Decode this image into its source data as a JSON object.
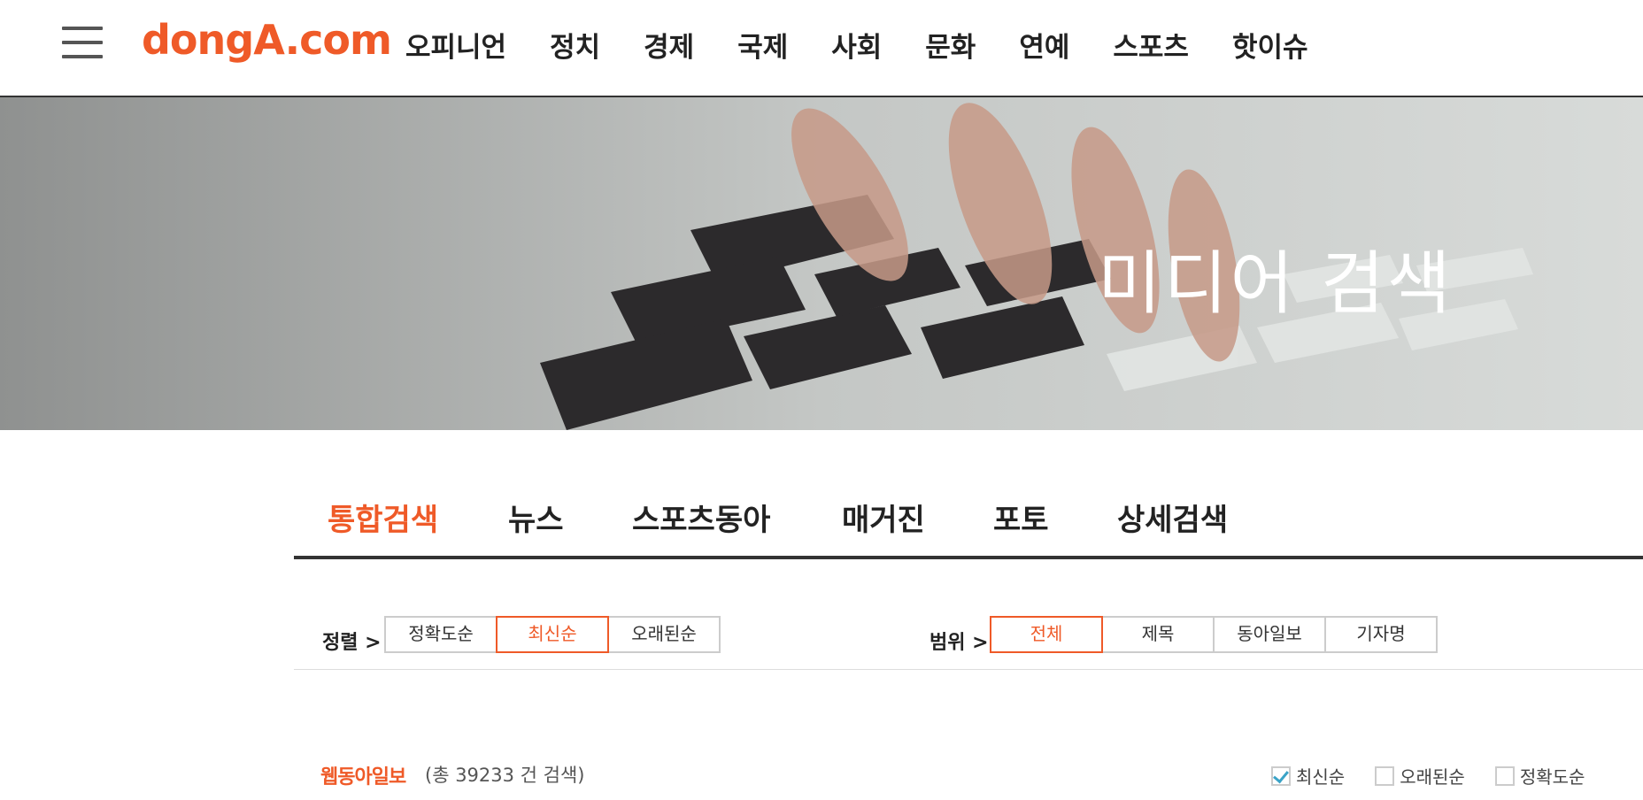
{
  "header": {
    "logo": "dongA.com",
    "menu_icon": "hamburger-menu-icon",
    "nav": [
      "오피니언",
      "정치",
      "경제",
      "국제",
      "사회",
      "문화",
      "연예",
      "스포츠",
      "핫이슈"
    ]
  },
  "hero": {
    "title": "미디어 검색"
  },
  "tabs": [
    "통합검색",
    "뉴스",
    "스포츠동아",
    "매거진",
    "포토",
    "상세검색"
  ],
  "active_tab": "통합검색",
  "sort": {
    "label": "정렬 >",
    "options": [
      "정확도순",
      "최신순",
      "오래된순"
    ],
    "active": "최신순"
  },
  "scope": {
    "label": "범위 >",
    "options": [
      "전체",
      "제목",
      "동아일보",
      "기자명"
    ],
    "active": "전체"
  },
  "result": {
    "section_title": "웹동아일보",
    "count_text": "(총 39233 건 검색)",
    "order_options": [
      {
        "label": "최신순",
        "checked": true
      },
      {
        "label": "오래된순",
        "checked": false
      },
      {
        "label": "정확도순",
        "checked": false
      }
    ]
  },
  "colors": {
    "accent": "#ef5a28",
    "check": "#3aa3c7"
  }
}
